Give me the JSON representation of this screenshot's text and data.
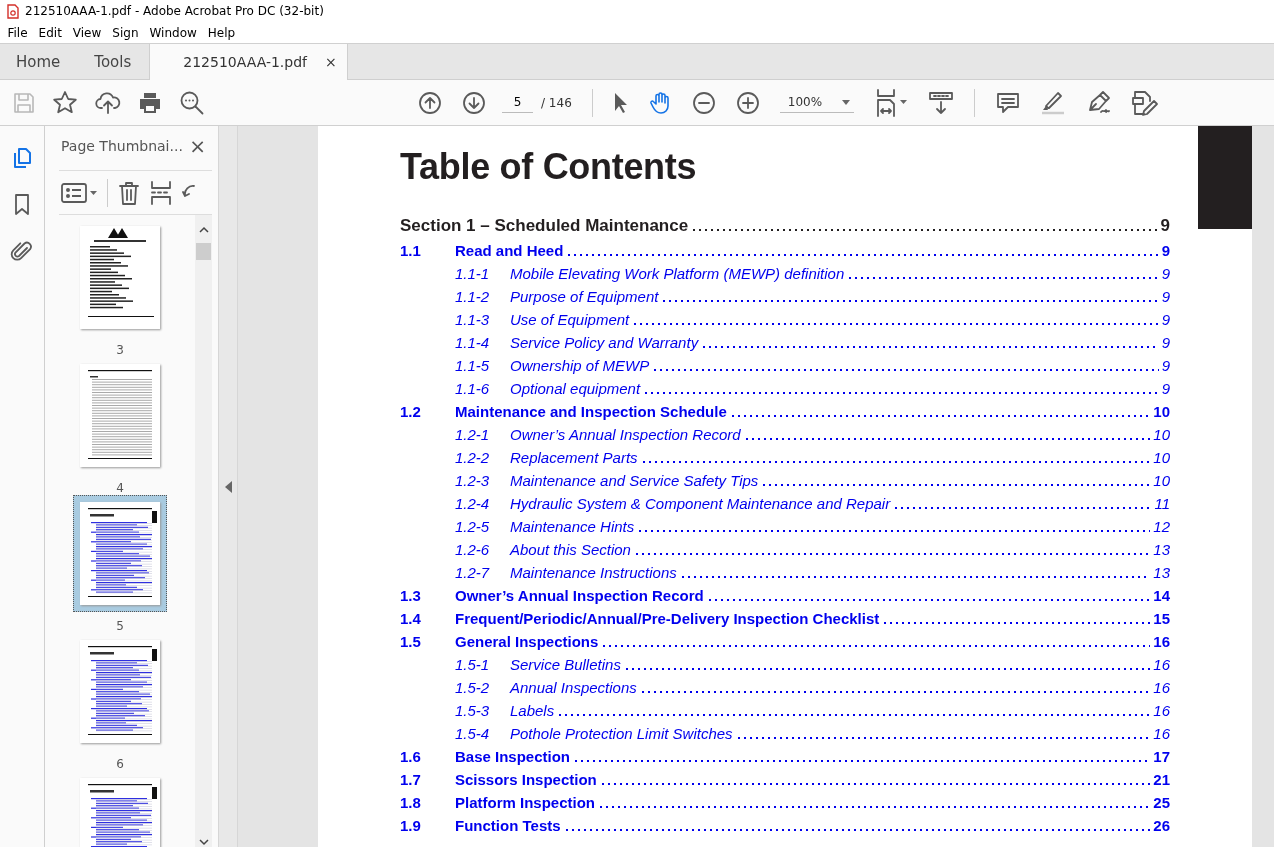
{
  "window": {
    "title": "212510AAA-1.pdf - Adobe Acrobat Pro DC (32-bit)"
  },
  "menu": [
    "File",
    "Edit",
    "View",
    "Sign",
    "Window",
    "Help"
  ],
  "tabs": [
    {
      "label": "Home",
      "selected": false,
      "kind": "nav"
    },
    {
      "label": "Tools",
      "selected": false,
      "kind": "nav"
    },
    {
      "label": "212510AAA-1.pdf",
      "selected": true,
      "kind": "document",
      "close": "×"
    }
  ],
  "toolbar": {
    "save_disabled": true,
    "page_field": {
      "value": "5"
    },
    "page_count": "/ 146",
    "pointer_tools": [
      {
        "selected": false
      },
      {
        "selected": true
      }
    ],
    "zoom": {
      "value": "100%"
    }
  },
  "rail_items": [
    {
      "selected": true
    },
    {
      "selected": false
    },
    {
      "selected": false
    }
  ],
  "thumbnail_panel": {
    "title": "Page Thumbnai...",
    "close": "×",
    "thumbnails": [
      {
        "label": "3",
        "selected": false,
        "kind": "warning"
      },
      {
        "label": "4",
        "selected": false,
        "kind": "ruled"
      },
      {
        "label": "5",
        "selected": true,
        "kind": "toc"
      },
      {
        "label": "6",
        "selected": false,
        "kind": "toc"
      },
      {
        "selected": false,
        "kind": "toc"
      }
    ]
  },
  "document": {
    "heading": "Table of Contents",
    "entries": [
      {
        "kind": "section",
        "title": "Section 1 – Scheduled Maintenance",
        "page": "9"
      },
      {
        "kind": "main",
        "number": "1.1",
        "title": "Read and Heed",
        "page": "9"
      },
      {
        "kind": "sub",
        "number": "1.1-1",
        "title": "Mobile Elevating Work Platform (MEWP) definition",
        "page": "9"
      },
      {
        "kind": "sub",
        "number": "1.1-2",
        "title": "Purpose of Equipment",
        "page": "9"
      },
      {
        "kind": "sub",
        "number": "1.1-3",
        "title": "Use of Equipment",
        "page": "9"
      },
      {
        "kind": "sub",
        "number": "1.1-4",
        "title": "Service Policy and Warranty",
        "page": "9"
      },
      {
        "kind": "sub",
        "number": "1.1-5",
        "title": "Ownership of MEWP",
        "page": "9"
      },
      {
        "kind": "sub",
        "number": "1.1-6",
        "title": "Optional equipment",
        "page": "9"
      },
      {
        "kind": "main",
        "number": "1.2",
        "title": "Maintenance and Inspection Schedule",
        "page": "10"
      },
      {
        "kind": "sub",
        "number": "1.2-1",
        "title": "Owner’s Annual Inspection Record",
        "page": "10"
      },
      {
        "kind": "sub",
        "number": "1.2-2",
        "title": "Replacement Parts",
        "page": "10"
      },
      {
        "kind": "sub",
        "number": "1.2-3",
        "title": "Maintenance and Service Safety Tips",
        "page": "10"
      },
      {
        "kind": "sub",
        "number": "1.2-4",
        "title": "Hydraulic System & Component Maintenance and Repair",
        "page": "11"
      },
      {
        "kind": "sub",
        "number": "1.2-5",
        "title": "Maintenance Hints",
        "page": "12"
      },
      {
        "kind": "sub",
        "number": "1.2-6",
        "title": "About this Section",
        "page": "13"
      },
      {
        "kind": "sub",
        "number": "1.2-7",
        "title": "Maintenance Instructions",
        "page": "13"
      },
      {
        "kind": "main",
        "number": "1.3",
        "title": "Owner’s Annual Inspection Record",
        "page": "14"
      },
      {
        "kind": "main",
        "number": "1.4",
        "title": "Frequent/Periodic/Annual/Pre-Delivery Inspection Checklist",
        "page": "15"
      },
      {
        "kind": "main",
        "number": "1.5",
        "title": "General Inspections",
        "page": "16"
      },
      {
        "kind": "sub",
        "number": "1.5-1",
        "title": "Service Bulletins",
        "page": "16"
      },
      {
        "kind": "sub",
        "number": "1.5-2",
        "title": "Annual Inspections",
        "page": "16"
      },
      {
        "kind": "sub",
        "number": "1.5-3",
        "title": "Labels",
        "page": "16"
      },
      {
        "kind": "sub",
        "number": "1.5-4",
        "title": "Pothole Protection Limit Switches",
        "page": "16"
      },
      {
        "kind": "main",
        "number": "1.6",
        "title": "Base Inspection",
        "page": "17"
      },
      {
        "kind": "main",
        "number": "1.7",
        "title": "Scissors Inspection",
        "page": "21"
      },
      {
        "kind": "main",
        "number": "1.8",
        "title": "Platform Inspection",
        "page": "25"
      },
      {
        "kind": "main",
        "number": "1.9",
        "title": "Function Tests",
        "page": "26"
      }
    ]
  }
}
